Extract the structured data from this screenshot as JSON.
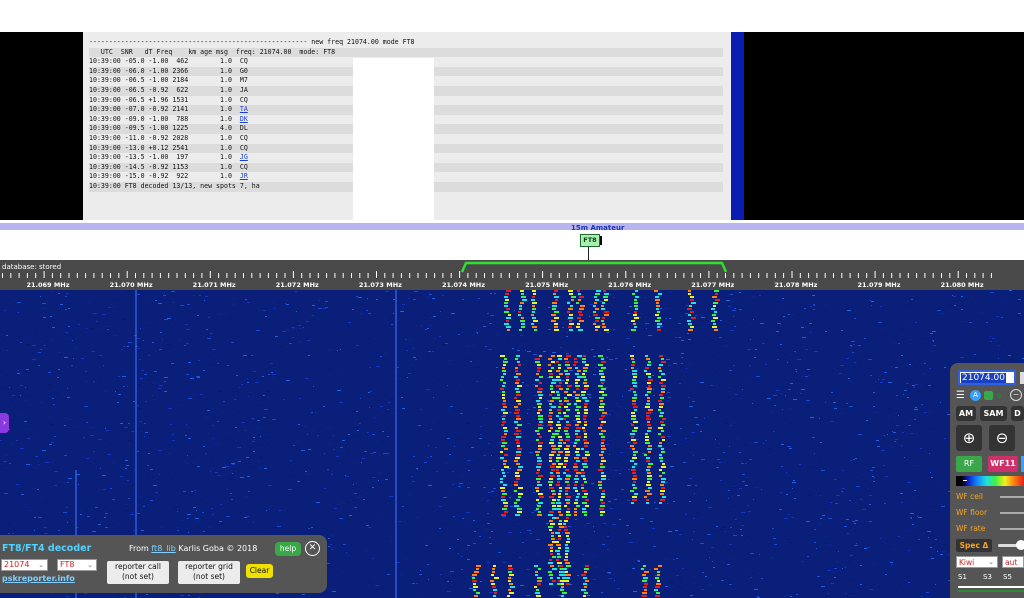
{
  "decoder_log": {
    "header_line": "------------------------------------------------------- new freq 21074.00 mode FT8",
    "col_header": "   UTC  SNR   dT Freq    km age msg  freq: 21074.00  mode: FT8",
    "rows": [
      {
        "text": "10:39:00 -05.0 -1.00  462        1.0  CQ",
        "link": false
      },
      {
        "text": "10:39:00 -06.0 -1.00 2366        1.0  G0",
        "link": false
      },
      {
        "text": "10:39:00 -06.5 -1.00 2184        1.0  M7",
        "link": false
      },
      {
        "text": "10:39:00 -06.5 -0.92  622        1.0  JA",
        "link": false
      },
      {
        "text": "10:39:00 -06.5 +1.96 1531        1.0  CQ",
        "link": false
      },
      {
        "text": "10:39:00 -07.0 -0.92 2141        1.0  ",
        "call": "TA",
        "link": true
      },
      {
        "text": "10:39:00 -09.0 -1.00  788        1.0  ",
        "call": "DK",
        "link": true
      },
      {
        "text": "10:39:00 -09.5 -1.00 1225        4.0  DL",
        "link": false
      },
      {
        "text": "10:39:00 -11.0 -0.92 2028        1.0  CQ",
        "link": false
      },
      {
        "text": "10:39:00 -13.0 +0.12 2541        1.0  CQ",
        "link": false
      },
      {
        "text": "10:39:00 -13.5 -1.00  197        1.0  ",
        "call": "JG",
        "link": true
      },
      {
        "text": "10:39:00 -14.5 -0.92 1153        1.0  CQ",
        "link": false
      },
      {
        "text": "10:39:00 -15.0 -0.92  922        1.0  ",
        "call": "JR",
        "link": true
      }
    ],
    "summary": "10:39:00 FT8 decoded 13/13, new spots 7, ha"
  },
  "band": {
    "label": "15m Amateur",
    "mode_tag": "FT8"
  },
  "scale": {
    "database_label": "database: stored",
    "ticks": [
      "21.069 MHz",
      "21.070 MHz",
      "21.071 MHz",
      "21.072 MHz",
      "21.073 MHz",
      "21.074 MHz",
      "21.075 MHz",
      "21.076 MHz",
      "21.077 MHz",
      "21.078 MHz",
      "21.079 MHz",
      "21.080 MHz"
    ]
  },
  "ft8_panel": {
    "title": "FT8/FT4 decoder",
    "from_prefix": "From ",
    "from_link": "ft8_lib",
    "from_suffix": " Karlis Goba © 2018",
    "help_label": "help",
    "freq_select": "21074",
    "mode_select": "FT8",
    "psk_link": "pskreporter.info",
    "reporter_call_line1": "reporter call",
    "reporter_call_line2": "(not set)",
    "reporter_grid_line1": "reporter grid",
    "reporter_grid_line2": "(not set)",
    "clear_label": "Clear"
  },
  "control_panel": {
    "frequency": "21074.00",
    "mode_am": "AM",
    "mode_sam": "SAM",
    "mode_d": "D",
    "rf_label": "RF",
    "wf_label": "WF11",
    "wf_ceil": "WF ceil",
    "wf_floor": "WF floor",
    "wf_rate": "WF rate",
    "spec_label": "Spec Δ",
    "kiwi_select": "Kiwi",
    "auto_select": "aut",
    "smeter": [
      "S1",
      "S3",
      "S5"
    ]
  }
}
